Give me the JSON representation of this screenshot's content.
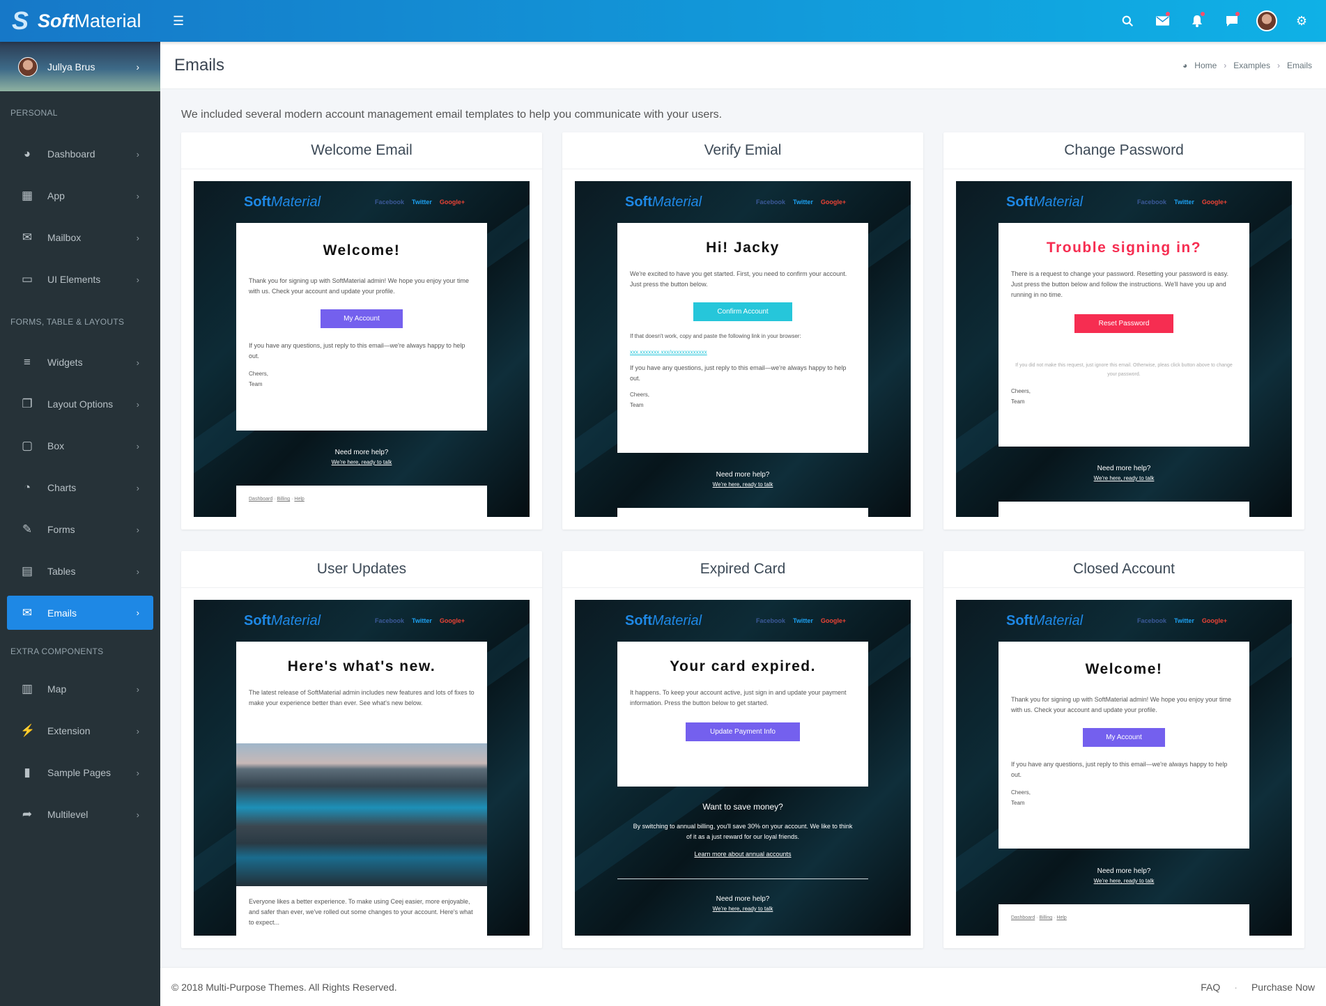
{
  "brand": {
    "soft": "Soft",
    "material": "Material"
  },
  "user": {
    "name": "Jullya Brus"
  },
  "page": {
    "title": "Emails",
    "intro": "We included several modern account management email templates to help you communicate with your users."
  },
  "breadcrumb": {
    "home": "Home",
    "examples": "Examples",
    "current": "Emails"
  },
  "sidebar": {
    "sections": [
      "PERSONAL",
      "FORMS, TABLE & LAYOUTS",
      "EXTRA COMPONENTS"
    ],
    "items": [
      {
        "label": "Dashboard",
        "icon": "dashboard-icon"
      },
      {
        "label": "App",
        "icon": "grid-icon"
      },
      {
        "label": "Mailbox",
        "icon": "envelope-icon"
      },
      {
        "label": "UI Elements",
        "icon": "laptop-icon"
      },
      {
        "label": "Widgets",
        "icon": "list-icon"
      },
      {
        "label": "Layout Options",
        "icon": "copy-icon"
      },
      {
        "label": "Box",
        "icon": "square-icon"
      },
      {
        "label": "Charts",
        "icon": "pie-chart-icon"
      },
      {
        "label": "Forms",
        "icon": "edit-icon"
      },
      {
        "label": "Tables",
        "icon": "table-icon"
      },
      {
        "label": "Emails",
        "icon": "envelope-open-icon"
      },
      {
        "label": "Map",
        "icon": "map-icon"
      },
      {
        "label": "Extension",
        "icon": "plug-icon"
      },
      {
        "label": "Sample Pages",
        "icon": "file-icon"
      },
      {
        "label": "Multilevel",
        "icon": "share-icon"
      }
    ]
  },
  "email": {
    "social": {
      "facebook": "Facebook",
      "twitter": "Twitter",
      "google": "Google+"
    },
    "help": {
      "title": "Need more help?",
      "link": "We're here, ready to talk"
    },
    "links": {
      "dashboard": "Dashboard",
      "billing": "Billing",
      "help": "Help"
    },
    "signoff": {
      "cheers": "Cheers,",
      "team": "Team"
    },
    "questions": "If you have any questions, just reply to this email—we're always happy to help out.",
    "questions2": "If you have any questions, just reply to this email—we're always happy to help out."
  },
  "cards": {
    "welcome": {
      "header": "Welcome Email",
      "title": "Welcome!",
      "text": "Thank you for signing up with SoftMaterial admin! We hope you enjoy your time with us. Check your account and update your profile.",
      "button": "My Account"
    },
    "verify": {
      "header": "Verify Emial",
      "title": "Hi! Jacky",
      "text": "We're excited to have you get started. First, you need to confirm your account. Just press the button below.",
      "button": "Confirm Account",
      "fallback": "If that doesn't work, copy and paste the following link in your browser:",
      "link": "xxx.xxxxxxx.xxx/xxxxxxxxxxxxx"
    },
    "password": {
      "header": "Change Password",
      "title": "Trouble signing in?",
      "text": "There is a request to change your password. Resetting your password is easy. Just press the button below and follow the instructions. We'll have you up and running in no time.",
      "button": "Reset Password",
      "note": "If you did not make this request, just ignore this email. Otherwise, pleas click button above to change your password."
    },
    "updates": {
      "header": "User Updates",
      "title": "Here's what's new.",
      "text": "The latest release of SoftMaterial admin includes new features and lots of fixes to make your experience better than ever. See what's new below.",
      "text2": "Everyone likes a better experience. To make using Ceej easier, more enjoyable, and safer than ever, we've rolled out some changes to your account. Here's what to expect..."
    },
    "expired": {
      "header": "Expired Card",
      "title": "Your card expired.",
      "text": "It happens. To keep your account active, just sign in and update your payment information. Press the button below to get started.",
      "button": "Update Payment Info",
      "save_title": "Want to save money?",
      "save_text": "By switching to annual billing, you'll save 30% on your account. We like to think of it as a just reward for our loyal friends.",
      "save_link": "Learn more about annual accounts"
    },
    "closed": {
      "header": "Closed Account",
      "title": "Welcome!",
      "text": "Thank you for signing up with SoftMaterial admin! We hope you enjoy your time with us. Check your account and update your profile.",
      "button": "My Account"
    }
  },
  "footer": {
    "copyright": "© 2018 Multi-Purpose Themes. All Rights Reserved.",
    "faq": "FAQ",
    "dot": "·",
    "purchase": "Purchase Now"
  },
  "colors": {
    "primary": "#1e88e5",
    "violet": "#7460ee",
    "cyan": "#26c6da",
    "red": "#f62d51"
  }
}
